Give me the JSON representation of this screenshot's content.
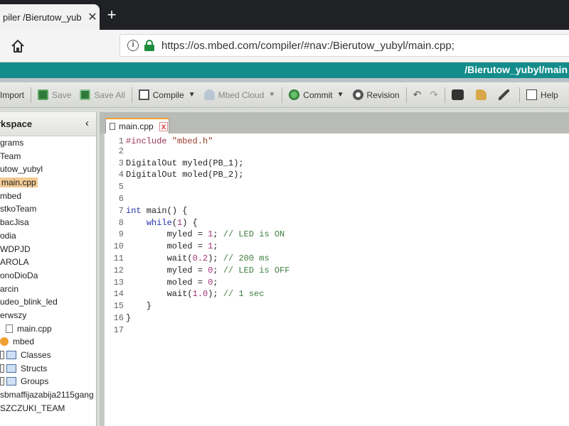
{
  "browser": {
    "tab_title": "piler /Bierutow_yub",
    "tab_close": "✕",
    "new_tab": "+",
    "url": "https://os.mbed.com/compiler/#nav:/Bierutow_yubyl/main.cpp;"
  },
  "app": {
    "header_path": "/Bierutow_yubyl/main"
  },
  "toolbar": {
    "import": "Import",
    "save": "Save",
    "save_all": "Save All",
    "compile": "Compile",
    "mbed_cloud": "Mbed Cloud",
    "commit": "Commit",
    "revision": "Revision",
    "help": "Help"
  },
  "sidebar": {
    "title": "orkspace",
    "collapse": "‹",
    "items": [
      {
        "label": "grams",
        "indent": 0,
        "icon": ""
      },
      {
        "label": "Team",
        "indent": 0,
        "icon": ""
      },
      {
        "label": "utow_yubyl",
        "indent": 0,
        "icon": ""
      },
      {
        "label": "main.cpp",
        "indent": 0,
        "icon": "",
        "selected": true
      },
      {
        "label": "mbed",
        "indent": 0,
        "icon": ""
      },
      {
        "label": "stkoTeam",
        "indent": 0,
        "icon": ""
      },
      {
        "label": "bacJisa",
        "indent": 0,
        "icon": ""
      },
      {
        "label": "odia",
        "indent": 0,
        "icon": ""
      },
      {
        "label": "WDPJD",
        "indent": 0,
        "icon": ""
      },
      {
        "label": "AROLA",
        "indent": 0,
        "icon": ""
      },
      {
        "label": "onoDioDa",
        "indent": 0,
        "icon": ""
      },
      {
        "label": "arcin",
        "indent": 0,
        "icon": ""
      },
      {
        "label": "udeo_blink_led",
        "indent": 0,
        "icon": ""
      },
      {
        "label": "erwszy",
        "indent": 0,
        "icon": ""
      },
      {
        "label": "main.cpp",
        "indent": 10,
        "icon": "file"
      },
      {
        "label": "mbed",
        "indent": 2,
        "icon": "lib"
      },
      {
        "label": "Classes",
        "indent": 2,
        "icon": "folder"
      },
      {
        "label": "Structs",
        "indent": 2,
        "icon": "folder"
      },
      {
        "label": "Groups",
        "indent": 2,
        "icon": "folder"
      },
      {
        "label": "sbmaffijazabija2115gang",
        "indent": 0,
        "icon": ""
      },
      {
        "label": "SZCZUKI_TEAM",
        "indent": 0,
        "icon": ""
      }
    ]
  },
  "editor": {
    "tab_label": "main.cpp",
    "tab_close": "x",
    "lines": [
      {
        "n": "1",
        "segs": [
          [
            "pp",
            "#include "
          ],
          [
            "str",
            "\"mbed.h\""
          ]
        ]
      },
      {
        "n": "2",
        "segs": []
      },
      {
        "n": "3",
        "segs": [
          [
            "tx",
            "DigitalOut myled(PB_1);"
          ]
        ]
      },
      {
        "n": "4",
        "segs": [
          [
            "tx",
            "DigitalOut moled(PB_2);"
          ]
        ]
      },
      {
        "n": "5",
        "segs": []
      },
      {
        "n": "6",
        "segs": []
      },
      {
        "n": "7",
        "segs": [
          [
            "kw",
            "int"
          ],
          [
            "tx",
            " main() {"
          ]
        ]
      },
      {
        "n": "8",
        "segs": [
          [
            "tx",
            "    "
          ],
          [
            "kw",
            "while"
          ],
          [
            "tx",
            "("
          ],
          [
            "num",
            "1"
          ],
          [
            "tx",
            ") {"
          ]
        ]
      },
      {
        "n": "9",
        "segs": [
          [
            "tx",
            "        myled = "
          ],
          [
            "num",
            "1"
          ],
          [
            "tx",
            "; "
          ],
          [
            "cm",
            "// LED is ON"
          ]
        ]
      },
      {
        "n": "10",
        "segs": [
          [
            "tx",
            "        moled = "
          ],
          [
            "num",
            "1"
          ],
          [
            "tx",
            ";"
          ]
        ]
      },
      {
        "n": "11",
        "segs": [
          [
            "tx",
            "        wait("
          ],
          [
            "num",
            "0.2"
          ],
          [
            "tx",
            "); "
          ],
          [
            "cm",
            "// 200 ms"
          ]
        ]
      },
      {
        "n": "12",
        "segs": [
          [
            "tx",
            "        myled = "
          ],
          [
            "num",
            "0"
          ],
          [
            "tx",
            "; "
          ],
          [
            "cm",
            "// LED is OFF"
          ]
        ]
      },
      {
        "n": "13",
        "segs": [
          [
            "tx",
            "        moled = "
          ],
          [
            "num",
            "0"
          ],
          [
            "tx",
            ";"
          ]
        ]
      },
      {
        "n": "14",
        "segs": [
          [
            "tx",
            "        wait("
          ],
          [
            "num",
            "1.0"
          ],
          [
            "tx",
            "); "
          ],
          [
            "cm",
            "// 1 sec"
          ]
        ]
      },
      {
        "n": "15",
        "segs": [
          [
            "tx",
            "    }"
          ]
        ]
      },
      {
        "n": "16",
        "segs": [
          [
            "tx",
            "}"
          ]
        ]
      },
      {
        "n": "17",
        "segs": []
      }
    ]
  }
}
